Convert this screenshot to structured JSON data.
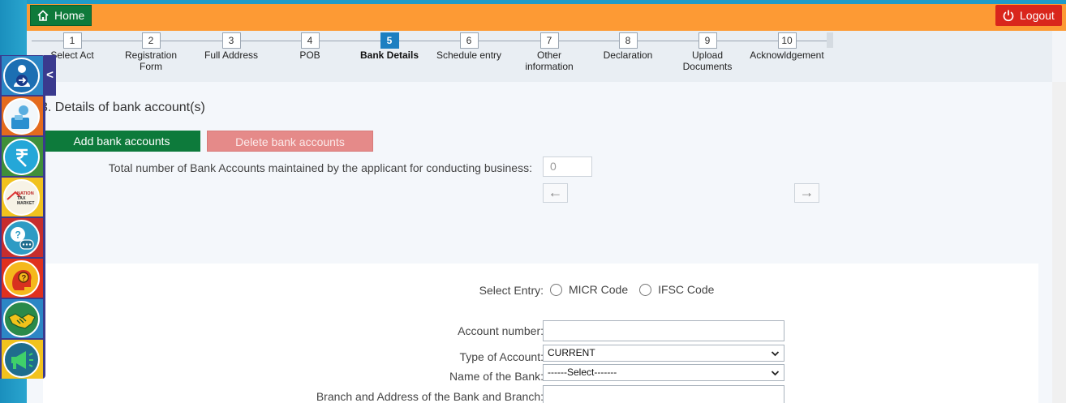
{
  "header": {
    "home_label": "Home",
    "logout_label": "Logout"
  },
  "steps": [
    {
      "num": "1",
      "label": "Select Act",
      "active": false
    },
    {
      "num": "2",
      "label": "Registration Form",
      "active": false
    },
    {
      "num": "3",
      "label": "Full Address",
      "active": false
    },
    {
      "num": "4",
      "label": "POB",
      "active": false
    },
    {
      "num": "5",
      "label": "Bank Details",
      "active": true
    },
    {
      "num": "6",
      "label": "Schedule entry",
      "active": false
    },
    {
      "num": "7",
      "label": "Other information",
      "active": false
    },
    {
      "num": "8",
      "label": "Declaration",
      "active": false
    },
    {
      "num": "9",
      "label": "Upload Documents",
      "active": false
    },
    {
      "num": "10",
      "label": "Acknowldgement",
      "active": false
    }
  ],
  "main": {
    "section_title": "3. Details of bank account(s)",
    "add_button": "Add bank accounts",
    "delete_button": "Delete bank accounts",
    "total_label": "Total number of Bank Accounts maintained by the applicant for conducting business:",
    "total_value": "0",
    "prev_arrow": "←",
    "next_arrow": "→"
  },
  "form": {
    "select_entry_label": "Select Entry:",
    "micr_label": "MICR Code",
    "ifsc_label": "IFSC Code",
    "account_number_label": "Account number:",
    "account_type_label": "Type of Account:",
    "account_type_value": "CURRENT",
    "bank_name_label": "Name of the Bank:",
    "bank_name_value": "------Select-------",
    "branch_label": "Branch and Address of the Bank and Branch:"
  },
  "sidebar": {
    "toggle": "<",
    "badge_lines": [
      "NATION",
      "TAX",
      "MARKET"
    ]
  },
  "colors": {
    "header_orange": "#fd9a34",
    "home_green": "#0f7a3b",
    "logout_red": "#d9261c",
    "active_step_blue": "#1d7fc1",
    "sidebar_purple": "#3a3a8e"
  }
}
